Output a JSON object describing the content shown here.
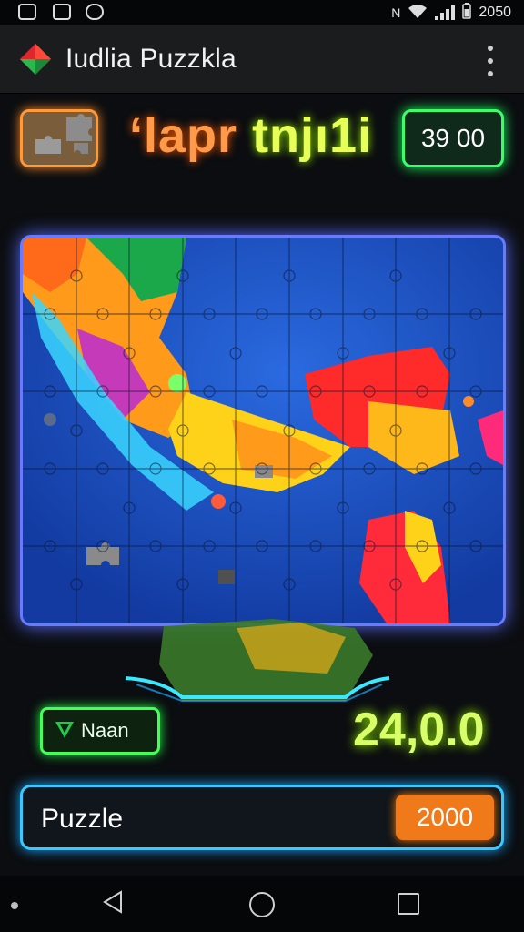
{
  "status_bar": {
    "time": "2050",
    "icons": [
      "photo-icon",
      "image-icon",
      "download-icon",
      "nfc-icon",
      "wifi-icon",
      "signal-icon",
      "battery-icon"
    ]
  },
  "app_bar": {
    "title": "Iudlia Puzzkla",
    "menu_icon": "more-vert-icon"
  },
  "header": {
    "title_part1": "‘lapr",
    "title_part2": "tnjı1i",
    "score_badge": "39 00"
  },
  "board": {
    "rows": 5,
    "cols": 9,
    "colors": {
      "ocean": "#1b47b8",
      "land_orange": "#ff9a1a",
      "land_yellow": "#ffd21a",
      "land_red": "#ff2a2a",
      "land_green": "#1aa84a",
      "land_magenta": "#c43ab8",
      "shallow": "#3ad6ff"
    }
  },
  "controls": {
    "name_button_label": "Naan",
    "big_score": "24,0.0",
    "puzzle_label": "Puzzle",
    "puzzle_value": "2000"
  },
  "nav_bar": {
    "icons": [
      "back-icon",
      "home-icon",
      "recents-icon"
    ]
  },
  "colors": {
    "neon_orange": "#ff9a3c",
    "neon_green": "#3aff6a",
    "neon_blue": "#6a7aff",
    "neon_cyan": "#3ac8ff",
    "accent_orange": "#f07a1a"
  }
}
